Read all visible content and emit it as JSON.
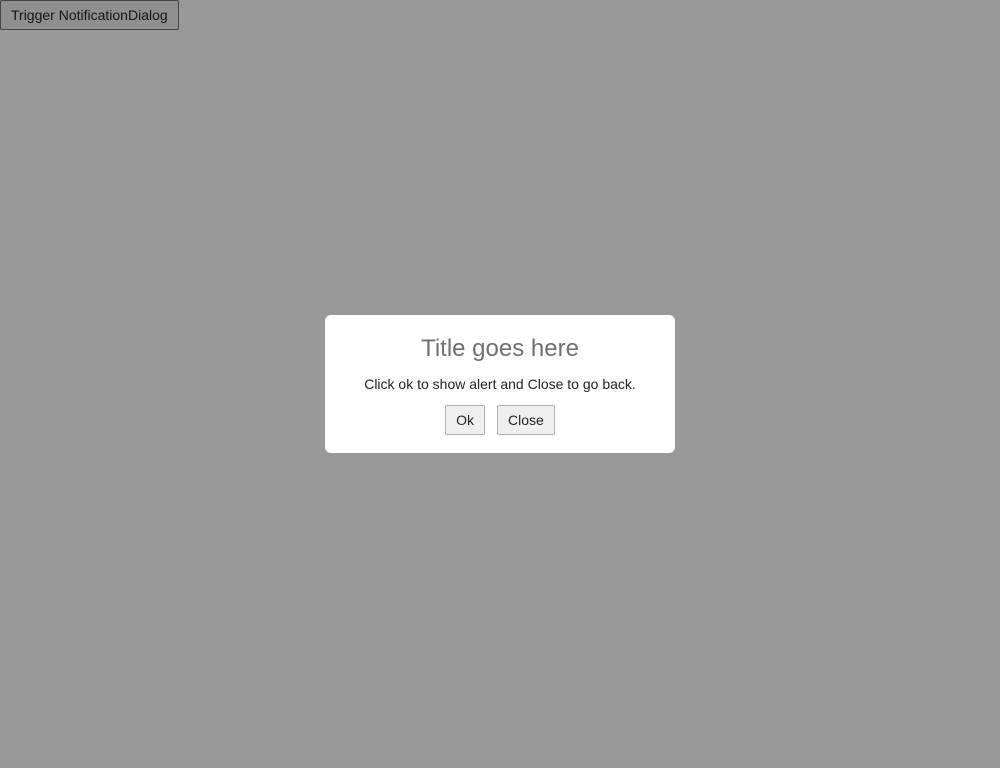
{
  "page": {
    "trigger_label": "Trigger NotificationDialog"
  },
  "dialog": {
    "title": "Title goes here",
    "message": "Click ok to show alert and Close to go back.",
    "ok_label": "Ok",
    "close_label": "Close"
  },
  "colors": {
    "overlay": "#999999",
    "dialog_background": "#ffffff",
    "title_text": "#707070"
  }
}
